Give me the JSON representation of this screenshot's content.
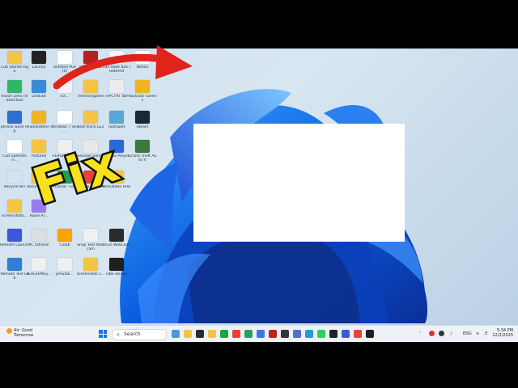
{
  "overlay": {
    "headline": "Fix"
  },
  "desktop_icons": [
    {
      "label": "Cult Stored Inqu",
      "icon": "folder-icon",
      "color": "#f5c443"
    },
    {
      "label": "Lanchy",
      "icon": "app-icon",
      "color": "#222222"
    },
    {
      "label": "Untitled PDF (2)",
      "icon": "file-icon",
      "color": "#ffffff"
    },
    {
      "label": "Openmaxes",
      "icon": "app-icon",
      "color": "#b52020"
    },
    {
      "label": "133 Slide Bits rootered",
      "icon": "file-icon",
      "color": "#f4f4f4"
    },
    {
      "label": "Notion",
      "icon": "notion-icon",
      "color": "#ffffff"
    },
    {
      "label": "Vision Lens (ViewsClass",
      "icon": "app-icon",
      "color": "#2eb86b"
    },
    {
      "label": "LiteEdit",
      "icon": "app-icon",
      "color": "#3b8ad8"
    },
    {
      "label": "Ex...",
      "icon": "file-icon",
      "color": "#f2f2f2"
    },
    {
      "label": "memorygame",
      "icon": "folder-icon",
      "color": "#f5c443"
    },
    {
      "label": "mPCTRT dbf",
      "icon": "file-icon",
      "color": "#ececec"
    },
    {
      "label": "Rockstar Games",
      "icon": "rockstar-icon",
      "color": "#f0b323"
    },
    {
      "label": "phrase word rep",
      "icon": "app-icon",
      "color": "#2f6fd1"
    },
    {
      "label": "nameathen",
      "icon": "app-icon",
      "color": "#f1b521"
    },
    {
      "label": "Windows 7 and ...",
      "icon": "file-icon",
      "color": "#ffffff"
    },
    {
      "label": "Fast track Lu3",
      "icon": "folder-icon",
      "color": "#f5c443"
    },
    {
      "label": "rootspad",
      "icon": "app-icon",
      "color": "#58a7d6"
    },
    {
      "label": "Steam",
      "icon": "steam-icon",
      "color": "#1b2838"
    },
    {
      "label": "Cult Somethin...",
      "icon": "file-icon",
      "color": "#ffffff"
    },
    {
      "label": "Pictures",
      "icon": "folder-icon",
      "color": "#f5c443"
    },
    {
      "label": "FERGHAN P...",
      "icon": "file-icon",
      "color": "#eeeeee"
    },
    {
      "label": "Session Samples P...",
      "icon": "file-icon",
      "color": "#e8e8e8"
    },
    {
      "label": "Roblox Player",
      "icon": "roblox-icon",
      "color": "#2a67d8"
    },
    {
      "label": "Grand Theft Auto V",
      "icon": "gta-icon",
      "color": "#3a7a3a"
    },
    {
      "label": "Recycle Bin",
      "icon": "recycle-bin-icon",
      "color": "#cfe4f6"
    },
    {
      "label": "documents...",
      "icon": "folder-icon",
      "color": "#f5c443"
    },
    {
      "label": "Personal - Edge",
      "icon": "edge-icon",
      "color": "#1fa34a"
    },
    {
      "label": "Google Chrome",
      "icon": "chrome-icon",
      "color": "#e84335"
    },
    {
      "label": "VirtualBox Files",
      "icon": "folder-icon",
      "color": "#f5c443"
    },
    {
      "label": "screenshots...",
      "icon": "folder-icon",
      "color": "#f5c443"
    },
    {
      "label": "Rosie Al...",
      "icon": "app-icon",
      "color": "#9b7cf0"
    },
    {
      "label": "Remote Launch",
      "icon": "app-icon",
      "color": "#3a58d8"
    },
    {
      "label": "PC rational",
      "icon": "file-icon",
      "color": "#dddddd"
    },
    {
      "label": "Colab",
      "icon": "app-icon",
      "color": "#f7a300"
    },
    {
      "label": "Snap Text Webcam",
      "icon": "file-icon",
      "color": "#f0f0f0"
    },
    {
      "label": "Iriun Webcam",
      "icon": "webcam-icon",
      "color": "#2c2c2c"
    },
    {
      "label": "Remote Test Lab",
      "icon": "app-icon",
      "color": "#2e7dd8"
    },
    {
      "label": "FERGHAN p...",
      "icon": "file-icon",
      "color": "#f0f0f0"
    },
    {
      "label": "pmudal...",
      "icon": "file-icon",
      "color": "#f0f0f0"
    },
    {
      "label": "screenshot-1...",
      "icon": "folder-icon",
      "color": "#f5c443"
    },
    {
      "label": "OBS Studio",
      "icon": "obs-icon",
      "color": "#1f1f1f"
    }
  ],
  "taskbar": {
    "weather_temp": "Air: Good",
    "weather_desc": "Tomorrow",
    "search_placeholder": "Search",
    "pinned_apps": [
      {
        "name": "widgets-icon",
        "color": "#4a9ad8"
      },
      {
        "name": "file-explorer-icon",
        "color": "#f5c443"
      },
      {
        "name": "terminal-icon",
        "color": "#2b2b2b"
      },
      {
        "name": "folder-icon",
        "color": "#f5c443"
      },
      {
        "name": "edge-icon",
        "color": "#1fa34a"
      },
      {
        "name": "chrome-icon",
        "color": "#e84335"
      },
      {
        "name": "notes-icon",
        "color": "#2e9e5b"
      },
      {
        "name": "store-icon",
        "color": "#3b78e7"
      },
      {
        "name": "record-icon",
        "color": "#c02020"
      },
      {
        "name": "notion-icon",
        "color": "#333333"
      },
      {
        "name": "app-icon",
        "color": "#4e73c8"
      },
      {
        "name": "app-icon",
        "color": "#1a9fd8"
      },
      {
        "name": "whatsapp-icon",
        "color": "#25d366"
      },
      {
        "name": "github-icon",
        "color": "#222222"
      },
      {
        "name": "app-icon",
        "color": "#3b5bdb"
      },
      {
        "name": "chrome-icon",
        "color": "#e84335"
      },
      {
        "name": "cmd-icon",
        "color": "#1e1e1e"
      }
    ],
    "tray_lang": "ENG",
    "clock_time": "5:34 PM",
    "clock_date": "12/2/2025"
  }
}
